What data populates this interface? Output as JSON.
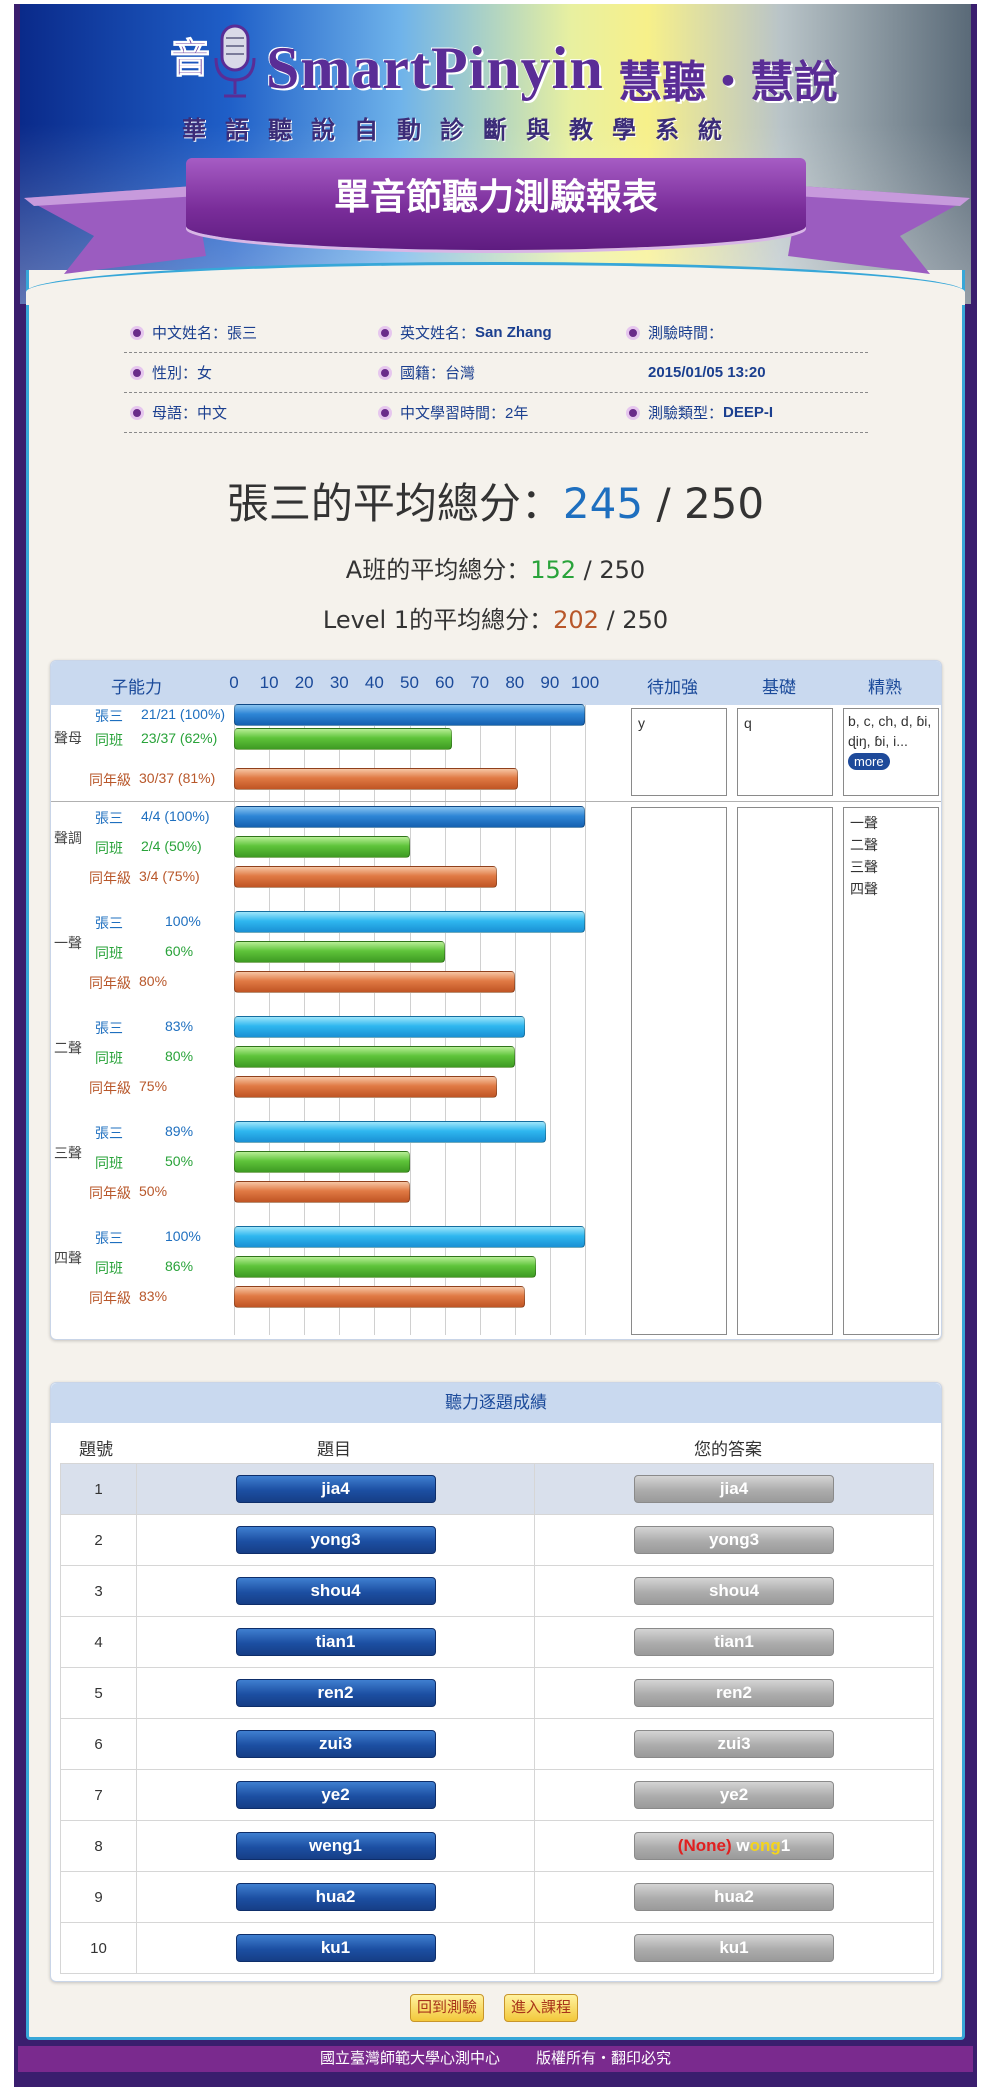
{
  "header": {
    "logo_text": "SmartPinyin",
    "logo_cn": "慧聽・慧說",
    "subtitle": "華語聽說自動診斷與教學系統",
    "ribbon_title": "單音節聽力測驗報表"
  },
  "info": {
    "cname_label": "中文姓名：",
    "cname": "張三",
    "ename_label": "英文姓名：",
    "ename": "San Zhang",
    "time_label": "測驗時間：",
    "time_value": "2015/01/05 13:20",
    "gender_label": "性別：",
    "gender": "女",
    "nation_label": "國籍：",
    "nation": "台灣",
    "tongue_label": "母語：",
    "tongue": "中文",
    "years_label": "中文學習時間：",
    "years": "2年",
    "type_label": "測驗類型：",
    "type": "DEEP-I"
  },
  "scores": {
    "main_label": "張三的平均總分：",
    "main": "245",
    "main_total": "/ 250",
    "class_label": "A班的平均總分：",
    "class": "152",
    "class_total": "/ 250",
    "level_label": "Level 1的平均總分：",
    "level": "202",
    "level_total": "/ 250"
  },
  "abilities": {
    "headers": {
      "subskill": "子能力",
      "weak": "待加強",
      "basic": "基礎",
      "master": "精熟"
    },
    "ticks": [
      "0",
      "10",
      "20",
      "30",
      "40",
      "50",
      "60",
      "70",
      "80",
      "90",
      "100"
    ],
    "groups": [
      {
        "name": "聲母",
        "rows": [
          {
            "who": "張三",
            "value": "21/21 (100%)",
            "pct": 100,
            "color": "blue"
          },
          {
            "who": "同班",
            "value": "23/37 (62%)",
            "pct": 62,
            "color": "green"
          },
          {
            "who": "同年級",
            "value": "30/37 (81%)",
            "pct": 81,
            "color": "orange"
          }
        ]
      },
      {
        "name": "聲調",
        "rows": [
          {
            "who": "張三",
            "value": "4/4 (100%)",
            "pct": 100,
            "color": "blue"
          },
          {
            "who": "同班",
            "value": "2/4 (50%)",
            "pct": 50,
            "color": "green"
          },
          {
            "who": "同年級",
            "value": "3/4 (75%)",
            "pct": 75,
            "color": "orange"
          }
        ]
      },
      {
        "name": "一聲",
        "rows": [
          {
            "who": "張三",
            "value": "100%",
            "pct": 100,
            "color": "cyan"
          },
          {
            "who": "同班",
            "value": "60%",
            "pct": 60,
            "color": "green"
          },
          {
            "who": "同年級",
            "value": "80%",
            "pct": 80,
            "color": "orange"
          }
        ]
      },
      {
        "name": "二聲",
        "rows": [
          {
            "who": "張三",
            "value": "83%",
            "pct": 83,
            "color": "cyan"
          },
          {
            "who": "同班",
            "value": "80%",
            "pct": 80,
            "color": "green"
          },
          {
            "who": "同年級",
            "value": "75%",
            "pct": 75,
            "color": "orange"
          }
        ]
      },
      {
        "name": "三聲",
        "rows": [
          {
            "who": "張三",
            "value": "89%",
            "pct": 89,
            "color": "cyan"
          },
          {
            "who": "同班",
            "value": "50%",
            "pct": 50,
            "color": "green"
          },
          {
            "who": "同年級",
            "value": "50%",
            "pct": 50,
            "color": "orange"
          }
        ]
      },
      {
        "name": "四聲",
        "rows": [
          {
            "who": "張三",
            "value": "100%",
            "pct": 100,
            "color": "cyan"
          },
          {
            "who": "同班",
            "value": "86%",
            "pct": 86,
            "color": "green"
          },
          {
            "who": "同年級",
            "value": "83%",
            "pct": 83,
            "color": "orange"
          }
        ]
      }
    ],
    "initials_weak": "y",
    "initials_basic": "q",
    "initials_master": "b, c, ch, d, ɓi, ɖiŋ, ɓi, i...",
    "more_label": "more",
    "tones_master": [
      "一聲",
      "二聲",
      "三聲",
      "四聲"
    ]
  },
  "quiz": {
    "title": "聽力逐題成績",
    "col_no": "題號",
    "col_item": "題目",
    "col_answer": "您的答案",
    "rows": [
      {
        "no": "1",
        "item": "jia4",
        "answer": "jia4"
      },
      {
        "no": "2",
        "item": "yong3",
        "answer": "yong3"
      },
      {
        "no": "3",
        "item": "shou4",
        "answer": "shou4"
      },
      {
        "no": "4",
        "item": "tian1",
        "answer": "tian1"
      },
      {
        "no": "5",
        "item": "ren2",
        "answer": "ren2"
      },
      {
        "no": "6",
        "item": "zui3",
        "answer": "zui3"
      },
      {
        "no": "7",
        "item": "ye2",
        "answer": "ye2"
      },
      {
        "no": "8",
        "item": "weng1",
        "answer_none": "(None)",
        "answer_w": "w",
        "answer_ong": "ong",
        "answer_tone": "1"
      },
      {
        "no": "9",
        "item": "hua2",
        "answer": "hua2"
      },
      {
        "no": "10",
        "item": "ku1",
        "answer": "ku1"
      }
    ]
  },
  "buttons": {
    "back": "回到測驗",
    "course": "進入課程"
  },
  "footer": {
    "org": "國立臺灣師範大學心測中心",
    "rights": "版權所有・翻印必究"
  },
  "colors": {
    "blue": "#1e6fbf",
    "green": "#29a33a",
    "orange": "#b8572a",
    "purple": "#7a2a8e"
  }
}
